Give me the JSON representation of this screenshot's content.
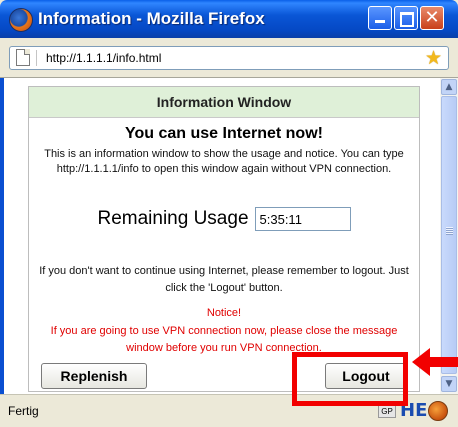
{
  "window": {
    "title": "Information - Mozilla Firefox"
  },
  "address": {
    "url": "http://1.1.1.1/info.html"
  },
  "panel": {
    "header": "Information Window",
    "headline": "You can use Internet now!",
    "description": "This is an information window to show the usage and notice. You can type http://1.1.1.1/info to open this window again without VPN connection.",
    "usage_label": "Remaining Usage",
    "usage_value": "5:35:11",
    "logout_note": "If you don't want to continue using Internet, please remember to logout. Just click the 'Logout' button.",
    "notice_title": "Notice!",
    "notice_text": "If you are going to use VPN connection now, please close the message window before you run VPN connection.",
    "replenish_label": "Replenish",
    "logout_label": "Logout"
  },
  "statusbar": {
    "text": "Fertig",
    "gp_label": "GP",
    "he_label": "HE"
  },
  "colors": {
    "titlebar": "#0548c4",
    "panel_header": "#dff0d8",
    "notice": "#e00000",
    "annotation": "#f20000"
  },
  "icons": [
    "firefox-logo-icon",
    "minimize-icon",
    "maximize-icon",
    "close-icon",
    "page-icon",
    "bookmark-star-icon",
    "scroll-up-icon",
    "scroll-down-icon",
    "firefox-status-icon"
  ]
}
